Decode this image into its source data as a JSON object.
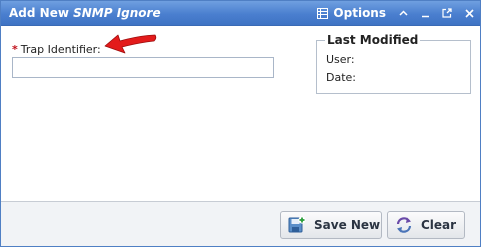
{
  "window": {
    "title_prefix": "Add New",
    "title_emph": "SNMP Ignore",
    "options_label": "Options"
  },
  "form": {
    "required_marker": "*",
    "trap_identifier_label": "Trap Identifier:",
    "trap_identifier_value": ""
  },
  "last_modified": {
    "legend": "Last Modified",
    "user_label": "User:",
    "date_label": "Date:"
  },
  "footer": {
    "save_new_label": "Save New",
    "clear_label": "Clear"
  },
  "colors": {
    "titlebar": "#4a7fcf",
    "required": "#c0101a",
    "arrow": "#e31b1b"
  },
  "icons": [
    "grid-icon",
    "collapse-icon",
    "minimize-icon",
    "popout-icon",
    "close-icon",
    "save-new-icon",
    "clear-icon",
    "red-arrow-icon"
  ]
}
